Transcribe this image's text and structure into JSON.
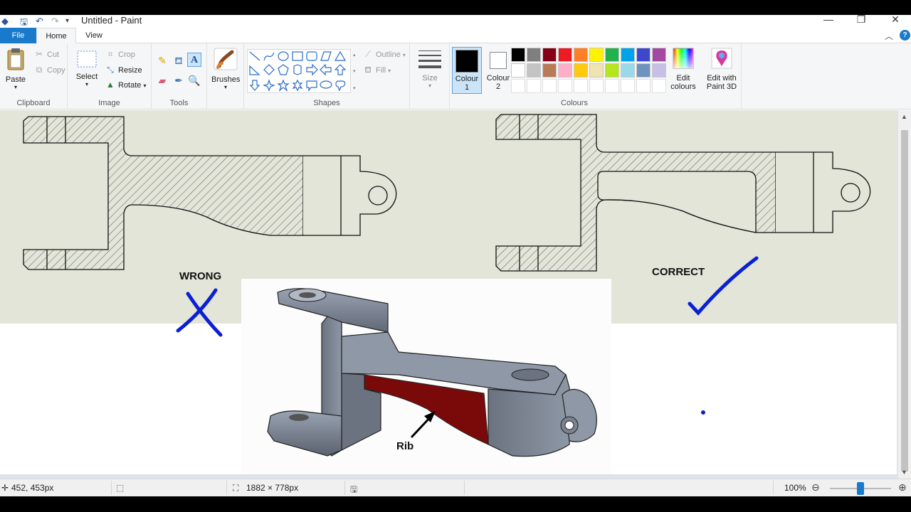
{
  "window": {
    "title": "Untitled - Paint",
    "minimize": "—",
    "restore": "❐",
    "close": "✕"
  },
  "tabs": {
    "file": "File",
    "home": "Home",
    "view": "View"
  },
  "ribbon": {
    "clipboard": {
      "label": "Clipboard",
      "paste": "Paste",
      "cut": "Cut",
      "copy": "Copy"
    },
    "image": {
      "label": "Image",
      "select": "Select",
      "crop": "Crop",
      "resize": "Resize",
      "rotate": "Rotate"
    },
    "tools": {
      "label": "Tools"
    },
    "brushes": {
      "label": "Brushes"
    },
    "shapes": {
      "label": "Shapes",
      "outline": "Outline",
      "fill": "Fill"
    },
    "size": {
      "label": "Size"
    },
    "colours": {
      "label": "Colours",
      "colour1_line1": "Colour",
      "colour1_line2": "1",
      "colour2_line1": "Colour",
      "colour2_line2": "2",
      "edit_line1": "Edit",
      "edit_line2": "colours",
      "paint3d_line1": "Edit with",
      "paint3d_line2": "Paint 3D",
      "colour1_value": "#000000",
      "colour2_value": "#ffffff",
      "palette_row1": [
        "#000000",
        "#7f7f7f",
        "#880015",
        "#ed1c24",
        "#ff7f27",
        "#fff200",
        "#22b14c",
        "#00a2e8",
        "#3f48cc",
        "#a349a4"
      ],
      "palette_row2": [
        "#ffffff",
        "#c3c3c3",
        "#b97a57",
        "#ffaec9",
        "#ffc90e",
        "#efe4b0",
        "#b5e61d",
        "#99d9ea",
        "#7092be",
        "#c8bfe7"
      ]
    }
  },
  "canvas": {
    "wrong_label": "WRONG",
    "correct_label": "CORRECT",
    "rib_label": "Rib",
    "bg_color": "#e2e5d8",
    "ink_color": "#0a1fd6",
    "rib_color": "#7a0a0a"
  },
  "status": {
    "cursor_pos": "452, 453px",
    "image_size": "1882 × 778px",
    "zoom": "100%"
  }
}
